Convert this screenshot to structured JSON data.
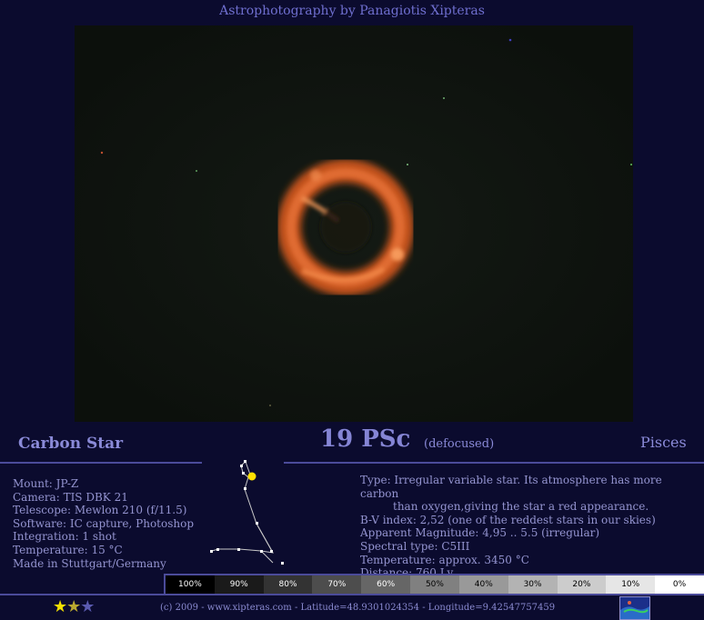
{
  "header": {
    "site_title": "Astrophotography by Panagiotis Xipteras"
  },
  "photo": {
    "alt": "Defocused carbon star image"
  },
  "titles": {
    "left": "Carbon Star",
    "main": "19 PSc",
    "sub": "(defocused)",
    "right": "Pisces"
  },
  "equipment": [
    "Mount: JP-Z",
    "Camera: TIS DBK 21",
    "Telescope: Mewlon 210 (f/11.5)",
    "Software: IC capture, Photoshop",
    "Integration: 1 shot",
    "Temperature: 15 °C",
    "Made in Stuttgart/Germany"
  ],
  "star_info": {
    "type_line1": "Type: Irregular variable star. Its atmosphere has more carbon",
    "type_line2": "than oxygen,giving the star a red appearance.",
    "bv_index": "B-V index: 2,52 (one of the reddest stars in our skies)",
    "magnitude": "Apparent Magnitude: 4,95 .. 5.5 (irregular)",
    "spectral": "Spectral type: C5III",
    "temperature": "Temperature: approx. 3450 °C",
    "distance": "Distance: 760 Ly"
  },
  "scale": [
    {
      "label": "100%",
      "bg": "#000000",
      "fg": "#ffffff"
    },
    {
      "label": "90%",
      "bg": "#1a1a1a",
      "fg": "#ffffff"
    },
    {
      "label": "80%",
      "bg": "#333333",
      "fg": "#ffffff"
    },
    {
      "label": "70%",
      "bg": "#4d4d4d",
      "fg": "#ffffff"
    },
    {
      "label": "60%",
      "bg": "#666666",
      "fg": "#ffffff"
    },
    {
      "label": "50%",
      "bg": "#808080",
      "fg": "#000000"
    },
    {
      "label": "40%",
      "bg": "#999999",
      "fg": "#000000"
    },
    {
      "label": "30%",
      "bg": "#b3b3b3",
      "fg": "#000000"
    },
    {
      "label": "20%",
      "bg": "#cccccc",
      "fg": "#000000"
    },
    {
      "label": "10%",
      "bg": "#e6e6e6",
      "fg": "#000000"
    },
    {
      "label": "0%",
      "bg": "#ffffff",
      "fg": "#000000"
    }
  ],
  "rating": {
    "value": 1.5,
    "max": 3,
    "full": "★",
    "half": "★",
    "empty": "★"
  },
  "footer": "(c) 2009 - www.xipteras.com - Latitude=48.9301024354 - Longitude=9.42547757459",
  "colors": {
    "background": "#0b0b2e",
    "text": "#9a9ad8",
    "rule": "#4b4b9a",
    "star_glow": "#e8743a"
  },
  "icons": {
    "thumbnail": "sky-map-thumbnail-icon"
  }
}
